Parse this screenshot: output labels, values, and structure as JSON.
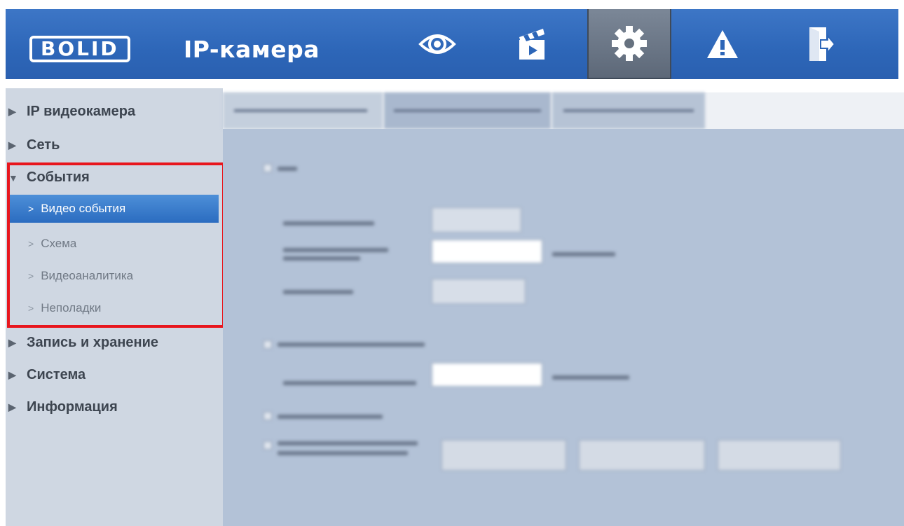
{
  "header": {
    "logo_text": "BOLID",
    "title": "IP-камера",
    "nav": [
      {
        "icon": "eye-icon"
      },
      {
        "icon": "clapperboard-icon"
      },
      {
        "icon": "gear-icon",
        "active": true
      },
      {
        "icon": "warning-icon"
      },
      {
        "icon": "exit-icon"
      }
    ]
  },
  "sidebar": {
    "items": [
      {
        "label": "IP видеокамера"
      },
      {
        "label": "Сеть"
      },
      {
        "label": "События",
        "expanded": true
      },
      {
        "label": "Запись и хранение"
      },
      {
        "label": "Система"
      },
      {
        "label": "Информация"
      }
    ],
    "sub_items": [
      {
        "label": "Видео события",
        "active": true
      },
      {
        "label": "Схема"
      },
      {
        "label": "Видеоаналитика"
      },
      {
        "label": "Неполадки"
      }
    ]
  },
  "colors": {
    "header_blue": "#2d66b8",
    "sidebar_bg": "#cfd7e2",
    "active_item": "#2b6cc0",
    "highlight_red": "#e8161d",
    "panel_bg": "#b3c2d7"
  }
}
